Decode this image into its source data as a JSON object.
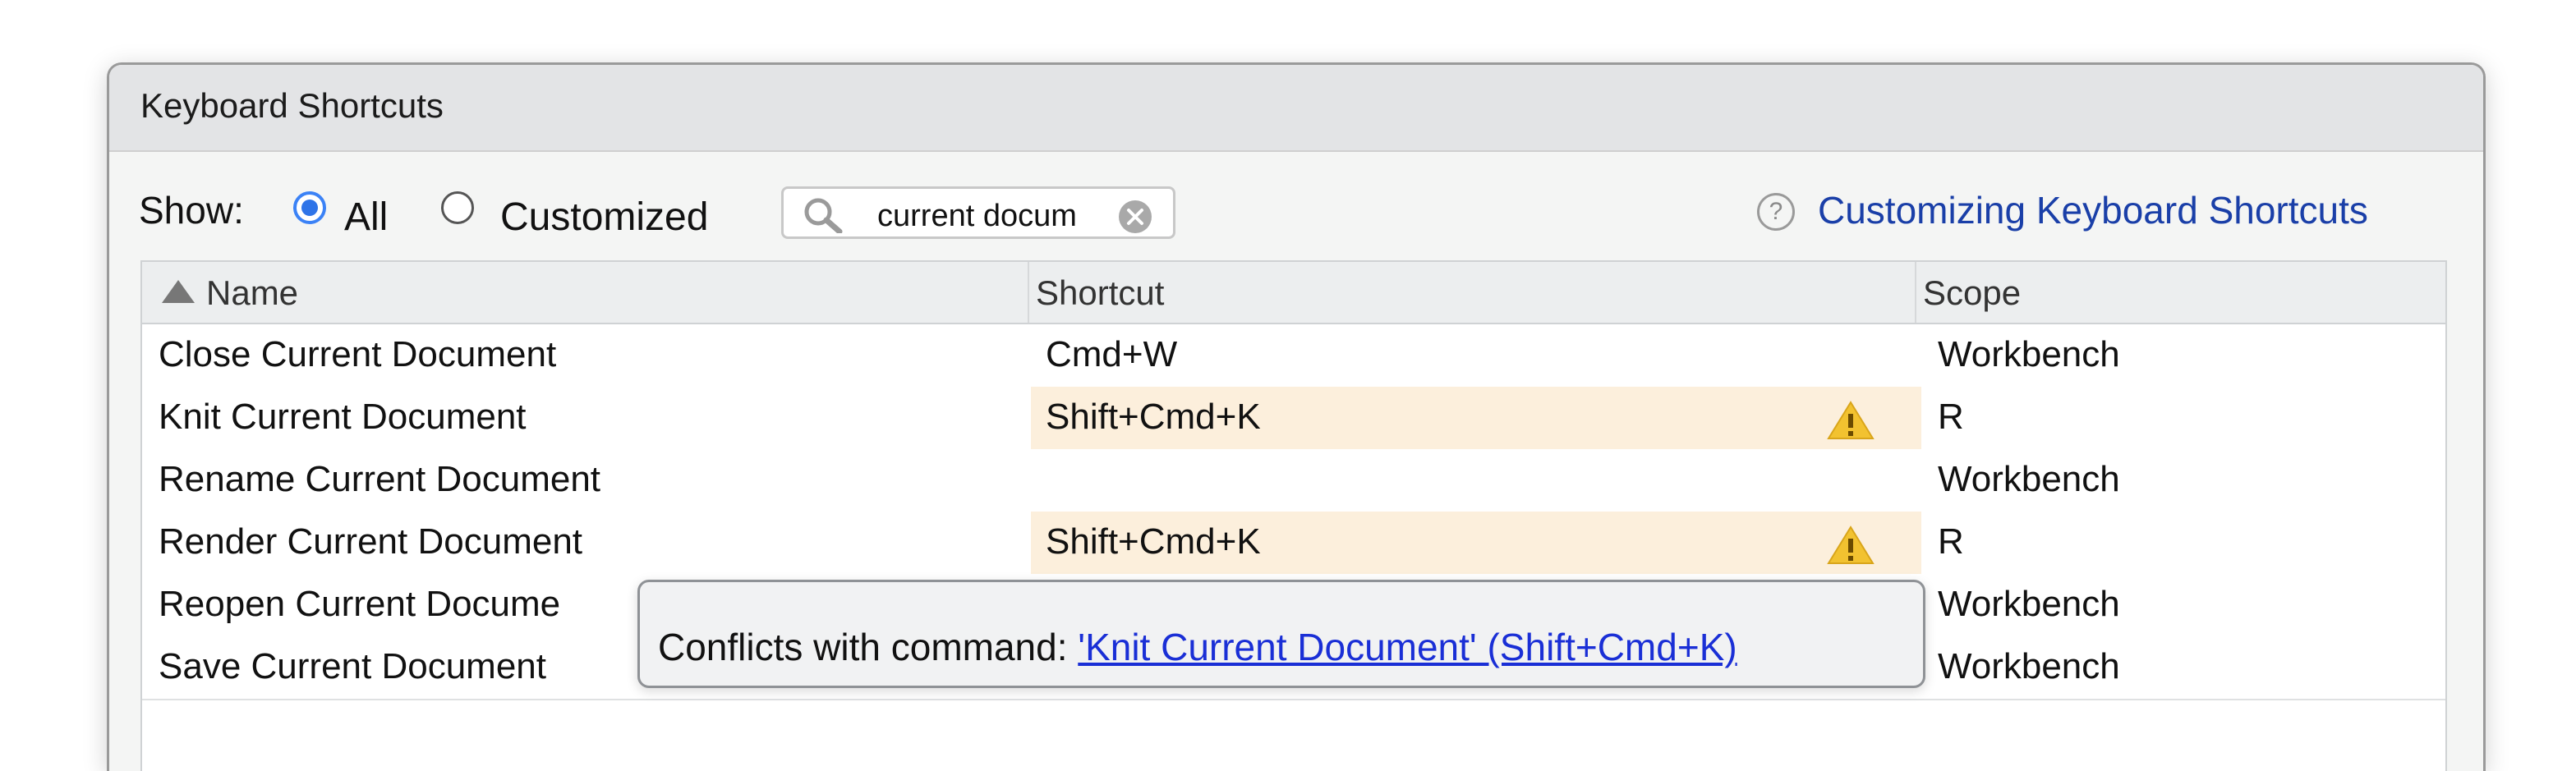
{
  "dialog": {
    "title": "Keyboard Shortcuts"
  },
  "filter": {
    "show_label": "Show:",
    "options": [
      {
        "label": "All",
        "selected": true
      },
      {
        "label": "Customized",
        "selected": false
      }
    ],
    "search_value": "current docum"
  },
  "help": {
    "icon": "question-circle-icon",
    "link_label": "Customizing Keyboard Shortcuts"
  },
  "table": {
    "sort": {
      "column": "Name",
      "direction": "ascending"
    },
    "columns": [
      "Name",
      "Shortcut",
      "Scope"
    ],
    "rows": [
      {
        "name": "Close Current Document",
        "shortcut": "Cmd+W",
        "scope": "Workbench",
        "conflict": false
      },
      {
        "name": "Knit Current Document",
        "shortcut": "Shift+Cmd+K",
        "scope": "R",
        "conflict": true
      },
      {
        "name": "Rename Current Document",
        "shortcut": "",
        "scope": "Workbench",
        "conflict": false
      },
      {
        "name": "Render Current Document",
        "shortcut": "Shift+Cmd+K",
        "scope": "R",
        "conflict": true
      },
      {
        "name": "Reopen Current Docume",
        "shortcut": "",
        "scope": "Workbench",
        "conflict": false
      },
      {
        "name": "Save Current Document",
        "shortcut": "",
        "scope": "Workbench",
        "conflict": false
      }
    ]
  },
  "tooltip": {
    "prefix": "Conflicts with command: ",
    "link": "'Knit Current Document' (Shift+Cmd+K)"
  },
  "colors": {
    "accent": "#2f74e8",
    "link": "#1a3fa8",
    "conflict_bg": "#fcefdc",
    "warning": "#f2c230"
  }
}
